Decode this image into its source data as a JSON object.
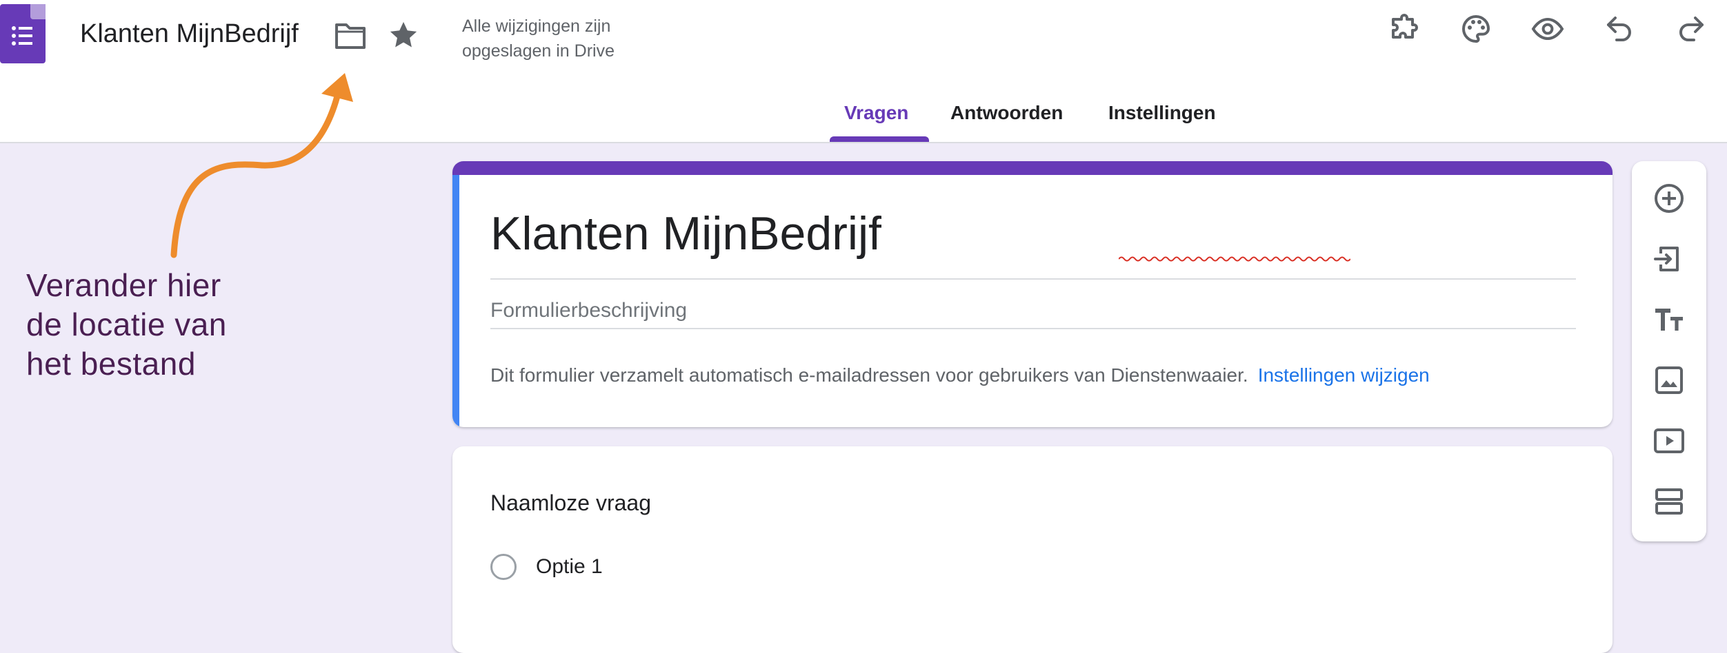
{
  "header": {
    "doc_title": "Klanten MijnBedrijf",
    "save_status_line1": "Alle wijzigingen zijn",
    "save_status_line2": "opgeslagen in Drive",
    "icons": {
      "app": "google-forms-icon",
      "folder": "folder-icon",
      "star": "star-icon",
      "addons": "puzzle-icon",
      "theme": "palette-icon",
      "preview": "eye-icon",
      "undo": "undo-icon",
      "redo": "redo-icon"
    }
  },
  "tabs": [
    {
      "label": "Vragen",
      "active": true
    },
    {
      "label": "Antwoorden",
      "active": false
    },
    {
      "label": "Instellingen",
      "active": false
    }
  ],
  "annotation": {
    "line1": "Verander hier",
    "line2": "de locatie van",
    "line3": "het bestand",
    "arrow_color": "#ee8c2c"
  },
  "form": {
    "title": "Klanten MijnBedrijf",
    "description_placeholder": "Formulierbeschrijving",
    "collect_note": "Dit formulier verzamelt automatisch e-mailadressen voor gebruikers van Dienstenwaaier.",
    "settings_link": "Instellingen wijzigen"
  },
  "question": {
    "title": "Naamloze vraag",
    "options": [
      "Optie 1"
    ]
  },
  "toolbar": [
    {
      "name": "add-question",
      "icon": "add-circle-icon"
    },
    {
      "name": "import-questions",
      "icon": "import-icon"
    },
    {
      "name": "add-title-description",
      "icon": "text-title-icon"
    },
    {
      "name": "add-image",
      "icon": "image-icon"
    },
    {
      "name": "add-video",
      "icon": "video-icon"
    },
    {
      "name": "add-section",
      "icon": "section-icon"
    }
  ],
  "colors": {
    "accent": "#673ab7",
    "page_background": "#efebf8",
    "left_accent": "#4285f4",
    "link": "#1a73e8",
    "annotation_text": "#4a1f52"
  }
}
